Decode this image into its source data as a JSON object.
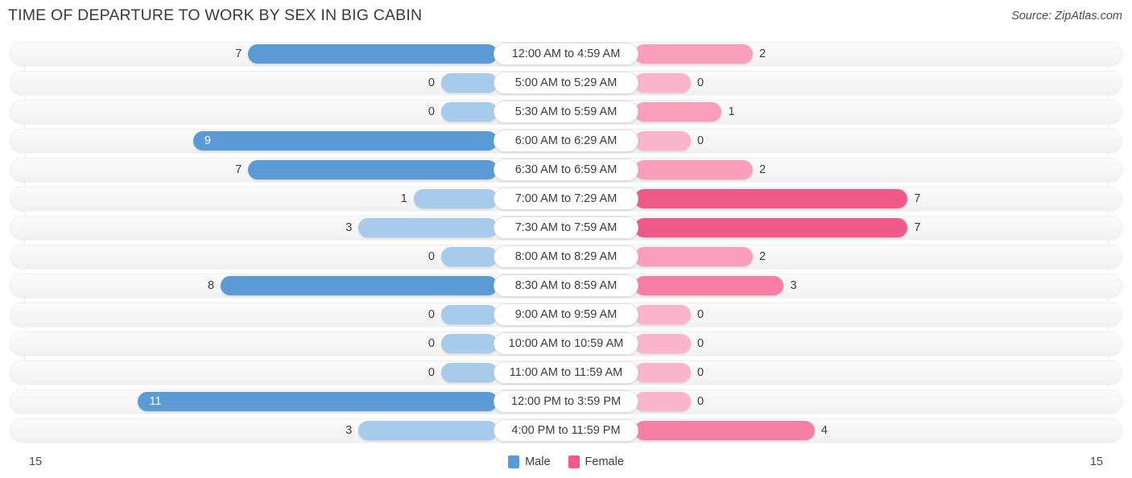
{
  "header": {
    "title": "TIME OF DEPARTURE TO WORK BY SEX IN BIG CABIN",
    "source": "Source: ZipAtlas.com"
  },
  "axis": {
    "left_label": "15",
    "right_label": "15",
    "max": 15
  },
  "legend": {
    "items": [
      {
        "label": "Male",
        "color": "#5b9bd5"
      },
      {
        "label": "Female",
        "color": "#f1598b"
      }
    ]
  },
  "chart_data": {
    "type": "bar",
    "title": "TIME OF DEPARTURE TO WORK BY SEX IN BIG CABIN",
    "orientation": "horizontal-diverging",
    "xlabel": "",
    "ylabel": "",
    "xlim": [
      15,
      15
    ],
    "grid": false,
    "legend_position": "bottom-center",
    "categories": [
      "12:00 AM to 4:59 AM",
      "5:00 AM to 5:29 AM",
      "5:30 AM to 5:59 AM",
      "6:00 AM to 6:29 AM",
      "6:30 AM to 6:59 AM",
      "7:00 AM to 7:29 AM",
      "7:30 AM to 7:59 AM",
      "8:00 AM to 8:29 AM",
      "8:30 AM to 8:59 AM",
      "9:00 AM to 9:59 AM",
      "10:00 AM to 10:59 AM",
      "11:00 AM to 11:59 AM",
      "12:00 PM to 3:59 PM",
      "4:00 PM to 11:59 PM"
    ],
    "series": [
      {
        "name": "Male",
        "values": [
          7,
          0,
          0,
          9,
          7,
          1,
          3,
          0,
          8,
          0,
          0,
          0,
          11,
          3
        ]
      },
      {
        "name": "Female",
        "values": [
          2,
          0,
          1,
          0,
          2,
          7,
          7,
          2,
          3,
          0,
          0,
          0,
          0,
          4
        ]
      }
    ]
  }
}
